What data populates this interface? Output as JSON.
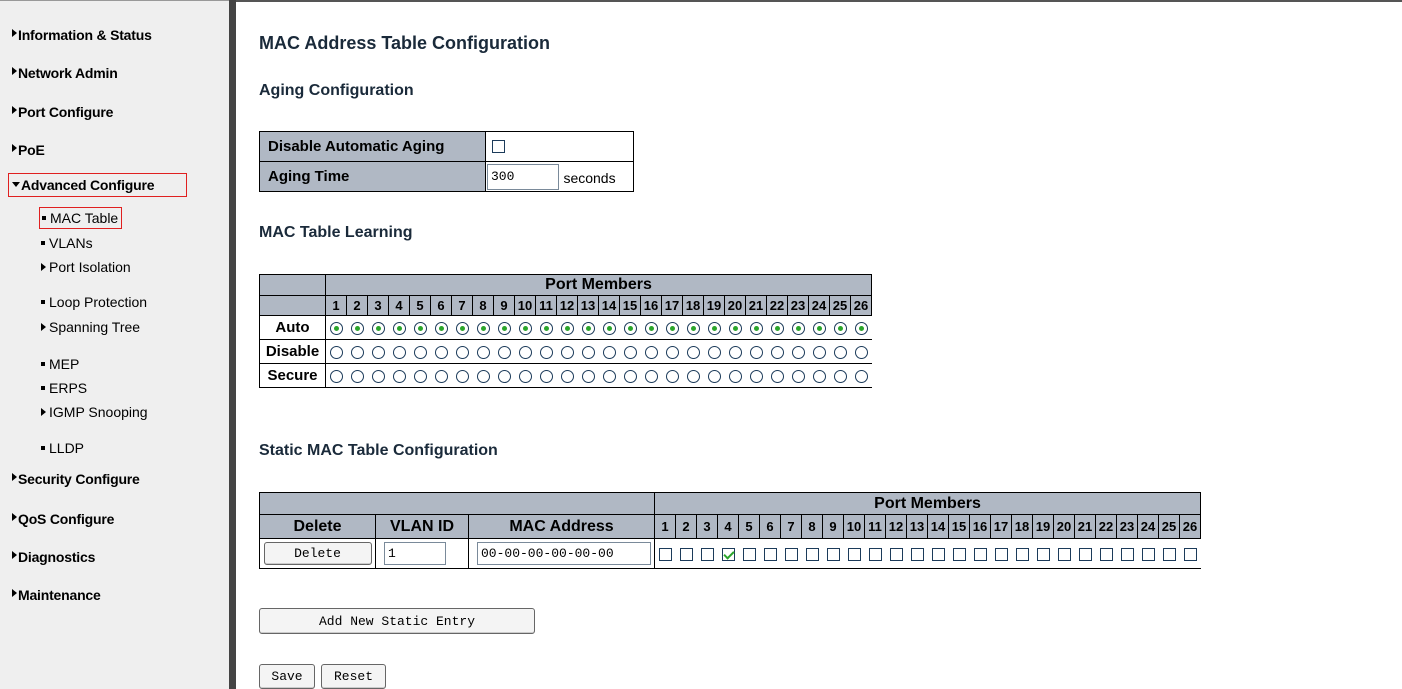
{
  "sidebar": {
    "items": [
      {
        "label": "Information & Status"
      },
      {
        "label": "Network Admin"
      },
      {
        "label": "Port Configure"
      },
      {
        "label": "PoE"
      },
      {
        "label": "Advanced Configure"
      },
      {
        "label": "Security Configure"
      },
      {
        "label": "QoS Configure"
      },
      {
        "label": "Diagnostics"
      },
      {
        "label": "Maintenance"
      }
    ],
    "subitems": [
      {
        "label": "MAC Table"
      },
      {
        "label": "VLANs"
      },
      {
        "label": "Port Isolation"
      },
      {
        "label": "Loop Protection"
      },
      {
        "label": "Spanning Tree"
      },
      {
        "label": "MEP"
      },
      {
        "label": "ERPS"
      },
      {
        "label": "IGMP Snooping"
      },
      {
        "label": "LLDP"
      }
    ]
  },
  "page": {
    "title": "MAC Address Table Configuration",
    "aging": {
      "title": "Aging Configuration",
      "disable_label": "Disable Automatic Aging",
      "disable_checked": false,
      "time_label": "Aging Time",
      "time_value": "300",
      "time_unit": "seconds"
    },
    "learning": {
      "title": "MAC Table Learning",
      "port_members_label": "Port Members",
      "ports": [
        "1",
        "2",
        "3",
        "4",
        "5",
        "6",
        "7",
        "8",
        "9",
        "10",
        "11",
        "12",
        "13",
        "14",
        "15",
        "16",
        "17",
        "18",
        "19",
        "20",
        "21",
        "22",
        "23",
        "24",
        "25",
        "26"
      ],
      "rows": [
        {
          "label": "Auto",
          "selected": true
        },
        {
          "label": "Disable",
          "selected": false
        },
        {
          "label": "Secure",
          "selected": false
        }
      ]
    },
    "static": {
      "title": "Static MAC Table Configuration",
      "port_members_label": "Port Members",
      "col_delete": "Delete",
      "col_vlan": "VLAN ID",
      "col_mac": "MAC Address",
      "ports": [
        "1",
        "2",
        "3",
        "4",
        "5",
        "6",
        "7",
        "8",
        "9",
        "10",
        "11",
        "12",
        "13",
        "14",
        "15",
        "16",
        "17",
        "18",
        "19",
        "20",
        "21",
        "22",
        "23",
        "24",
        "25",
        "26"
      ],
      "entry": {
        "delete_button": "Delete",
        "vlan_id": "1",
        "mac": "00-00-00-00-00-00",
        "checked_ports": [
          "4"
        ]
      }
    },
    "buttons": {
      "add_entry": "Add New Static Entry",
      "save": "Save",
      "reset": "Reset"
    }
  }
}
